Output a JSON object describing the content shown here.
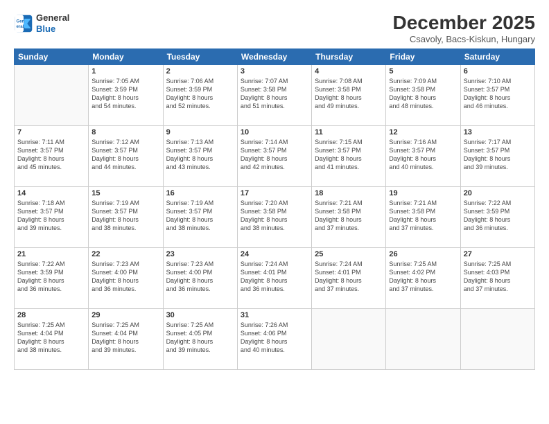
{
  "logo": {
    "line1": "General",
    "line2": "Blue"
  },
  "title": "December 2025",
  "location": "Csavoly, Bacs-Kiskun, Hungary",
  "days_of_week": [
    "Sunday",
    "Monday",
    "Tuesday",
    "Wednesday",
    "Thursday",
    "Friday",
    "Saturday"
  ],
  "weeks": [
    [
      {
        "day": "",
        "info": ""
      },
      {
        "day": "1",
        "info": "Sunrise: 7:05 AM\nSunset: 3:59 PM\nDaylight: 8 hours\nand 54 minutes."
      },
      {
        "day": "2",
        "info": "Sunrise: 7:06 AM\nSunset: 3:59 PM\nDaylight: 8 hours\nand 52 minutes."
      },
      {
        "day": "3",
        "info": "Sunrise: 7:07 AM\nSunset: 3:58 PM\nDaylight: 8 hours\nand 51 minutes."
      },
      {
        "day": "4",
        "info": "Sunrise: 7:08 AM\nSunset: 3:58 PM\nDaylight: 8 hours\nand 49 minutes."
      },
      {
        "day": "5",
        "info": "Sunrise: 7:09 AM\nSunset: 3:58 PM\nDaylight: 8 hours\nand 48 minutes."
      },
      {
        "day": "6",
        "info": "Sunrise: 7:10 AM\nSunset: 3:57 PM\nDaylight: 8 hours\nand 46 minutes."
      }
    ],
    [
      {
        "day": "7",
        "info": "Sunrise: 7:11 AM\nSunset: 3:57 PM\nDaylight: 8 hours\nand 45 minutes."
      },
      {
        "day": "8",
        "info": "Sunrise: 7:12 AM\nSunset: 3:57 PM\nDaylight: 8 hours\nand 44 minutes."
      },
      {
        "day": "9",
        "info": "Sunrise: 7:13 AM\nSunset: 3:57 PM\nDaylight: 8 hours\nand 43 minutes."
      },
      {
        "day": "10",
        "info": "Sunrise: 7:14 AM\nSunset: 3:57 PM\nDaylight: 8 hours\nand 42 minutes."
      },
      {
        "day": "11",
        "info": "Sunrise: 7:15 AM\nSunset: 3:57 PM\nDaylight: 8 hours\nand 41 minutes."
      },
      {
        "day": "12",
        "info": "Sunrise: 7:16 AM\nSunset: 3:57 PM\nDaylight: 8 hours\nand 40 minutes."
      },
      {
        "day": "13",
        "info": "Sunrise: 7:17 AM\nSunset: 3:57 PM\nDaylight: 8 hours\nand 39 minutes."
      }
    ],
    [
      {
        "day": "14",
        "info": "Sunrise: 7:18 AM\nSunset: 3:57 PM\nDaylight: 8 hours\nand 39 minutes."
      },
      {
        "day": "15",
        "info": "Sunrise: 7:19 AM\nSunset: 3:57 PM\nDaylight: 8 hours\nand 38 minutes."
      },
      {
        "day": "16",
        "info": "Sunrise: 7:19 AM\nSunset: 3:57 PM\nDaylight: 8 hours\nand 38 minutes."
      },
      {
        "day": "17",
        "info": "Sunrise: 7:20 AM\nSunset: 3:58 PM\nDaylight: 8 hours\nand 38 minutes."
      },
      {
        "day": "18",
        "info": "Sunrise: 7:21 AM\nSunset: 3:58 PM\nDaylight: 8 hours\nand 37 minutes."
      },
      {
        "day": "19",
        "info": "Sunrise: 7:21 AM\nSunset: 3:58 PM\nDaylight: 8 hours\nand 37 minutes."
      },
      {
        "day": "20",
        "info": "Sunrise: 7:22 AM\nSunset: 3:59 PM\nDaylight: 8 hours\nand 36 minutes."
      }
    ],
    [
      {
        "day": "21",
        "info": "Sunrise: 7:22 AM\nSunset: 3:59 PM\nDaylight: 8 hours\nand 36 minutes."
      },
      {
        "day": "22",
        "info": "Sunrise: 7:23 AM\nSunset: 4:00 PM\nDaylight: 8 hours\nand 36 minutes."
      },
      {
        "day": "23",
        "info": "Sunrise: 7:23 AM\nSunset: 4:00 PM\nDaylight: 8 hours\nand 36 minutes."
      },
      {
        "day": "24",
        "info": "Sunrise: 7:24 AM\nSunset: 4:01 PM\nDaylight: 8 hours\nand 36 minutes."
      },
      {
        "day": "25",
        "info": "Sunrise: 7:24 AM\nSunset: 4:01 PM\nDaylight: 8 hours\nand 37 minutes."
      },
      {
        "day": "26",
        "info": "Sunrise: 7:25 AM\nSunset: 4:02 PM\nDaylight: 8 hours\nand 37 minutes."
      },
      {
        "day": "27",
        "info": "Sunrise: 7:25 AM\nSunset: 4:03 PM\nDaylight: 8 hours\nand 37 minutes."
      }
    ],
    [
      {
        "day": "28",
        "info": "Sunrise: 7:25 AM\nSunset: 4:04 PM\nDaylight: 8 hours\nand 38 minutes."
      },
      {
        "day": "29",
        "info": "Sunrise: 7:25 AM\nSunset: 4:04 PM\nDaylight: 8 hours\nand 39 minutes."
      },
      {
        "day": "30",
        "info": "Sunrise: 7:25 AM\nSunset: 4:05 PM\nDaylight: 8 hours\nand 39 minutes."
      },
      {
        "day": "31",
        "info": "Sunrise: 7:26 AM\nSunset: 4:06 PM\nDaylight: 8 hours\nand 40 minutes."
      },
      {
        "day": "",
        "info": ""
      },
      {
        "day": "",
        "info": ""
      },
      {
        "day": "",
        "info": ""
      }
    ]
  ]
}
